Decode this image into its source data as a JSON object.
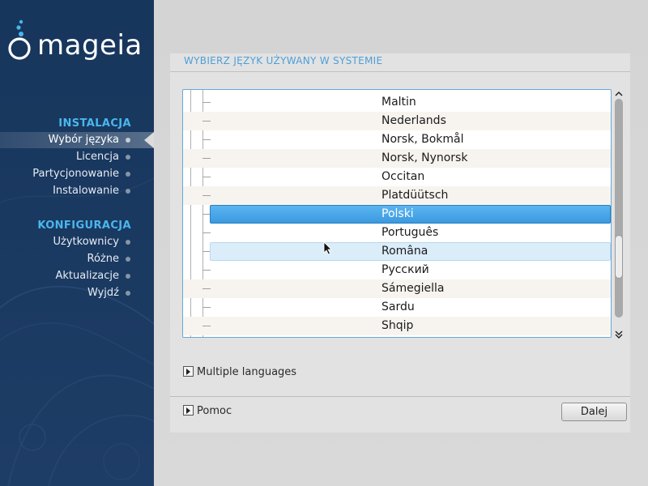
{
  "sidebar": {
    "logo_text": "mageia",
    "sections": [
      {
        "title": "INSTALACJA",
        "items": [
          {
            "label": "Wybór języka",
            "active": true
          },
          {
            "label": "Licencja",
            "active": false
          },
          {
            "label": "Partycjonowanie",
            "active": false
          },
          {
            "label": "Instalowanie",
            "active": false
          }
        ]
      },
      {
        "title": "KONFIGURACJA",
        "items": [
          {
            "label": "Użytkownicy",
            "active": false
          },
          {
            "label": "Różne",
            "active": false
          },
          {
            "label": "Aktualizacje",
            "active": false
          },
          {
            "label": "Wyjdź",
            "active": false
          }
        ]
      }
    ]
  },
  "main": {
    "heading": "WYBIERZ JĘZYK UŻYWANY W SYSTEMIE",
    "languages": [
      "Maltin",
      "Nederlands",
      "Norsk, Bokmål",
      "Norsk, Nynorsk",
      "Occitan",
      "Platdüütsch",
      "Polski",
      "Português",
      "Româna",
      "Русский",
      "Sámegiella",
      "Sardu",
      "Shqip"
    ],
    "selected_language": "Polski",
    "hovered_language": "Româna",
    "multiple_languages_label": "Multiple languages",
    "help_label": "Pomoc",
    "next_button_label": "Dalej"
  },
  "colors": {
    "sidebar_bg": "#1b3a62",
    "section_title": "#4ab6ee",
    "heading": "#4d9fd8",
    "selection": "#3b99e0"
  }
}
